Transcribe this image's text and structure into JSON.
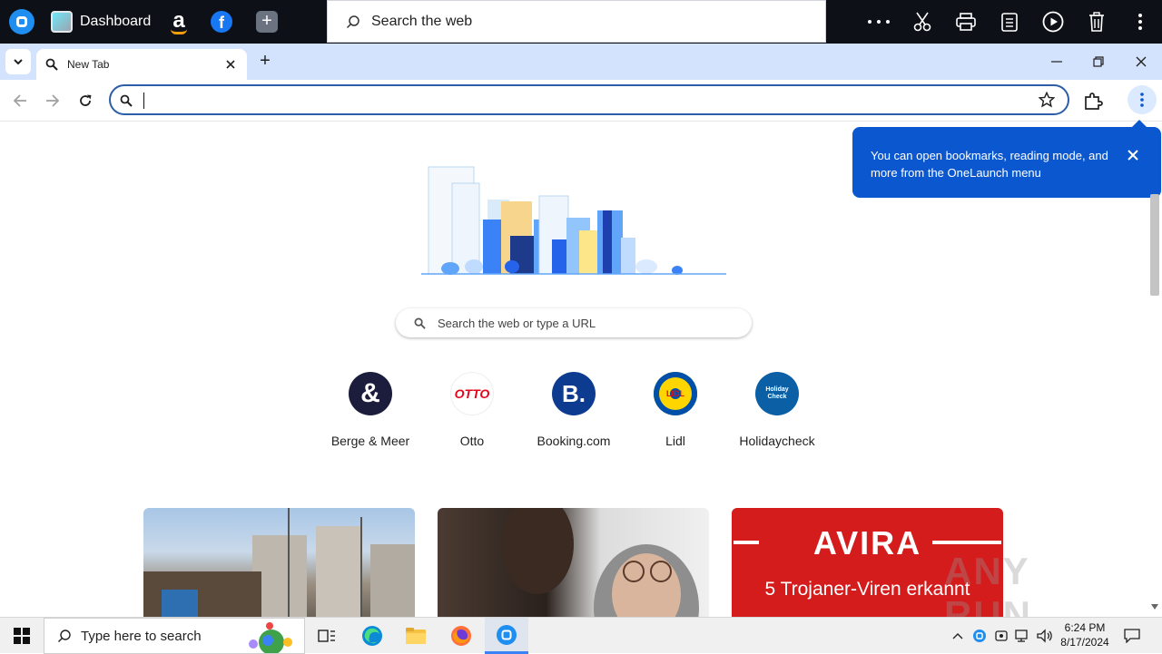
{
  "onelaunch_bar": {
    "dashboard_label": "Dashboard",
    "search_placeholder": "Search the web",
    "tools": [
      "more-icon",
      "scissors-icon",
      "printer-icon",
      "notepad-icon",
      "play-icon",
      "trash-icon",
      "kebab-menu-icon"
    ]
  },
  "browser": {
    "tab_title": "New Tab",
    "new_tab_label": "+",
    "omnibox_value": ""
  },
  "popup": {
    "text": "You can open bookmarks, reading mode, and more from the OneLaunch menu"
  },
  "ntp": {
    "search_placeholder": "Search the web or type a URL",
    "shortcuts": [
      {
        "label": "Berge & Meer",
        "glyph": "&",
        "bg": "#1c1c3c",
        "fg": "#ffffff"
      },
      {
        "label": "Otto",
        "glyph": "OTTO",
        "bg": "#ffffff",
        "fg": "#e3051b"
      },
      {
        "label": "Booking.com",
        "glyph": "B.",
        "bg": "#0c3b8f",
        "fg": "#ffffff"
      },
      {
        "label": "Lidl",
        "glyph": "LIDL",
        "bg": "#0050aa",
        "fg": "#e60a14"
      },
      {
        "label": "Holidaycheck",
        "glyph": "Holiday Check",
        "bg": "#0b5fa5",
        "fg": "#ffffff"
      }
    ],
    "cards": [
      {
        "title": ""
      },
      {
        "title": ""
      },
      {
        "brand": "AVIRA",
        "subtitle": "5 Trojaner-Viren erkannt"
      }
    ]
  },
  "watermark": "ANY RUN",
  "taskbar": {
    "search_placeholder": "Type here to search",
    "time": "6:24 PM",
    "date": "8/17/2024"
  },
  "colors": {
    "accent": "#0b57d0",
    "tabstrip": "#d3e3fd",
    "omnibox_border": "#2b5ea7",
    "avira_red": "#d41c1c"
  }
}
